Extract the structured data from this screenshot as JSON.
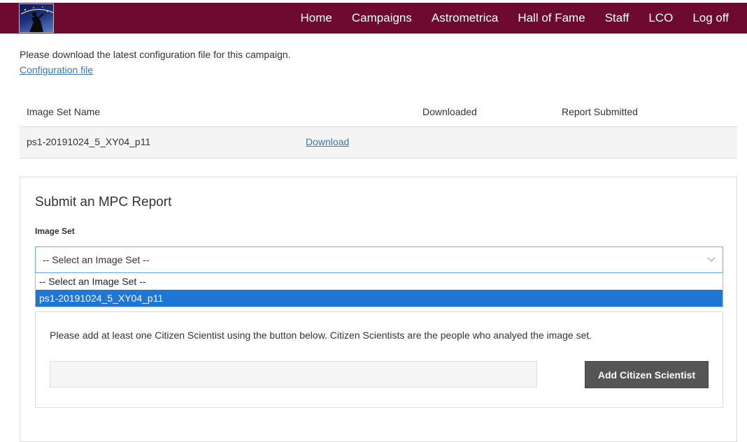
{
  "nav": {
    "links": [
      "Home",
      "Campaigns",
      "Astrometrica",
      "Hall of Fame",
      "Staff",
      "LCO",
      "Log off"
    ]
  },
  "intro": {
    "text": "Please download the latest configuration file for this campaign.",
    "config_link": "Configuration file"
  },
  "table": {
    "headers": [
      "Image Set Name",
      "",
      "Downloaded",
      "Report Submitted"
    ],
    "rows": [
      {
        "name": "ps1-20191024_5_XY04_p11",
        "action": "Download",
        "downloaded": "",
        "report": ""
      }
    ]
  },
  "report": {
    "title": "Submit an MPC Report",
    "image_set_label": "Image Set",
    "select_value": "-- Select an Image Set --",
    "options": [
      "-- Select an Image Set --",
      "ps1-20191024_5_XY04_p11"
    ],
    "highlighted_option": "ps1-20191024_5_XY04_p11",
    "citizen_text": "Please add at least one Citizen Scientist using the button below. Citizen Scientists are the people who analyed the image set.",
    "citizen_input_value": "",
    "add_button": "Add Citizen Scientist"
  },
  "icons": {
    "logo": "astronomer-silhouette-logo",
    "select_arrow": "chevron-down-icon"
  },
  "colors": {
    "navbar": "#6d0a2e",
    "link": "#3a78b5",
    "highlight": "#1e76d6",
    "button": "#555555"
  }
}
